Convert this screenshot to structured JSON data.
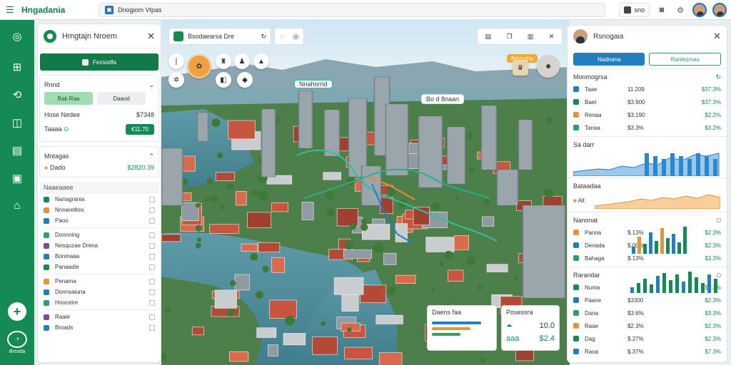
{
  "app": {
    "brand": "Hngadania",
    "tab_title": "Dnogiom Vtpas"
  },
  "top": {
    "chip_label": "sno"
  },
  "rail": {
    "bottom_label": "Brsnda"
  },
  "left_panel": {
    "title": "Hmgtajn Nroem",
    "primary_button": "Fezsodfa",
    "card1": {
      "title": "Rnnd",
      "toggle_on": "Bak Raa",
      "toggle_off": "Daaod",
      "row1_label": "Hose Nedee",
      "row1_value": "$7348",
      "row2_label": "Taaaa",
      "button": "€11.70"
    },
    "card2": {
      "title": "Mntagas",
      "row_label": "Dado",
      "row_value": "$2820.39"
    },
    "section_label": "Naaeaaee",
    "items": [
      "Nanagrania",
      "Nnnarelltes",
      "Paoo",
      "Donnning",
      "Nesquzae Drena",
      "Bonmaaa",
      "Panaadie",
      "Penama",
      "Donnsaiuna",
      "Hooceire",
      "Raaie",
      "Broads"
    ],
    "colors": [
      "#158a55",
      "#e8923a",
      "#1f7fc0",
      "#2aa06a",
      "#7a4aa0",
      "#1f7fc0"
    ]
  },
  "map_toolbar": {
    "label": "Bsodaearsa Dre"
  },
  "map_labels": {
    "tag1": "Nnahornd",
    "tag2": "Bo d 8naan",
    "callout": "Nooghs"
  },
  "map_overlay": {
    "card1_title": "Daens  faa",
    "card2_title": "Posessra",
    "card2_num": "10.0",
    "card2_value": "$2.4",
    "card2_pct": "aaa"
  },
  "right_panel": {
    "title": "Rsnogaia",
    "tab_a": "Nadnana",
    "tab_b": "Ranlezmas",
    "sec1_title": "Monmogrsa",
    "sec1_rows": [
      {
        "name": "Taae",
        "value": "11.209",
        "pct": "$37.3%"
      },
      {
        "name": "Baet",
        "value": "$3.900",
        "pct": "$37.3%"
      },
      {
        "name": "Renaa",
        "value": "$3.190",
        "pct": "$2.2%"
      },
      {
        "name": "Tanaa",
        "value": "$3.3%",
        "pct": "$3.2%"
      }
    ],
    "chart1_title": "Sa darr",
    "chart2_title": "Bataadaa",
    "chart2_sub": "Alt",
    "sec3_title": "Nanonat",
    "sec3_rows": [
      {
        "name": "Panoa",
        "value": "$.13%",
        "pct": "$2.3%"
      },
      {
        "name": "Denada",
        "value": "$.00%",
        "pct": "$2.3%"
      },
      {
        "name": "Bahaga",
        "value": "$.13%",
        "pct": "$3.3%"
      }
    ],
    "sec4_title": "Rarandar",
    "sec4_rows": [
      {
        "name": "Numa",
        "value": "",
        "pct": "$7.3%"
      },
      {
        "name": "Paane",
        "value": "$3300",
        "pct": "$2.3%"
      },
      {
        "name": "Dana",
        "value": "$3.6%",
        "pct": "$3.3%"
      },
      {
        "name": "Raae",
        "value": "$2.3%",
        "pct": "$2.3%"
      },
      {
        "name": "Dag",
        "value": "$.27%",
        "pct": "$2.3%"
      },
      {
        "name": "Raoa",
        "value": "$.37%",
        "pct": "$7.3%"
      }
    ]
  }
}
